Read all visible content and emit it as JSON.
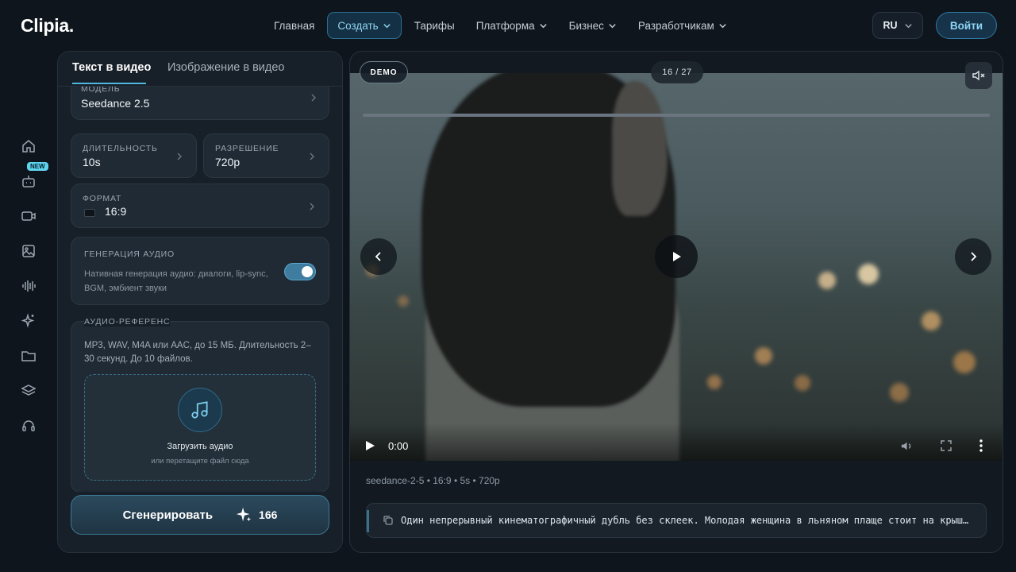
{
  "brand": {
    "logo": "Clipia."
  },
  "nav": {
    "items": [
      {
        "label": "Главная",
        "dropdown": false,
        "active": false
      },
      {
        "label": "Создать",
        "dropdown": true,
        "active": true
      },
      {
        "label": "Тарифы",
        "dropdown": false,
        "active": false
      },
      {
        "label": "Платформа",
        "dropdown": true,
        "active": false
      },
      {
        "label": "Бизнес",
        "dropdown": true,
        "active": false
      },
      {
        "label": "Разработчикам",
        "dropdown": true,
        "active": false
      }
    ],
    "language": "RU",
    "login": "Войти"
  },
  "rail": {
    "icons": [
      "home-icon",
      "robot-icon",
      "video-camera-icon",
      "image-icon",
      "audio-wave-icon",
      "sparkles-icon",
      "folder-icon",
      "layers-icon",
      "headset-icon"
    ],
    "new_badge": "NEW"
  },
  "panel": {
    "tabs": [
      "Текст в видео",
      "Изображение в видео"
    ],
    "model": {
      "label": "Модель",
      "value": "Seedance 2.5"
    },
    "duration": {
      "label": "Длительность",
      "value": "10s"
    },
    "resolution": {
      "label": "Разрешение",
      "value": "720p"
    },
    "format": {
      "label": "Формат",
      "value": "16:9"
    },
    "audio_gen": {
      "title": "Генерация аудио",
      "description": "Нативная генерация аудио: диалоги, lip-sync, BGM, эмбиент звуки",
      "enabled": true
    },
    "audio_ref": {
      "title": "Аудио-референс",
      "description": "MP3, WAV, M4A или AAC, до 15 МБ. Длительность 2–30 секунд. До 10 файлов.",
      "upload_title": "Загрузить аудио",
      "upload_hint": "или перетащите файл сюда"
    },
    "generate": {
      "label": "Сгенерировать",
      "cost": "166"
    }
  },
  "preview": {
    "demo_badge": "DEMO",
    "counter": "16 / 27",
    "player": {
      "time": "0:00",
      "progress": 0
    },
    "meta": "seedance-2-5 • 16:9 • 5s • 720p",
    "prompt": "Один непрерывный кинематографичный дубль без склеек. Молодая женщина в льняном плаще стоит на крыше на закате, ветер развевает её волосы, внизу размытые огни города."
  },
  "colors": {
    "accent": "#4fb7df",
    "background": "#0f151c",
    "panel": "#171f28",
    "card": "#202a34"
  }
}
